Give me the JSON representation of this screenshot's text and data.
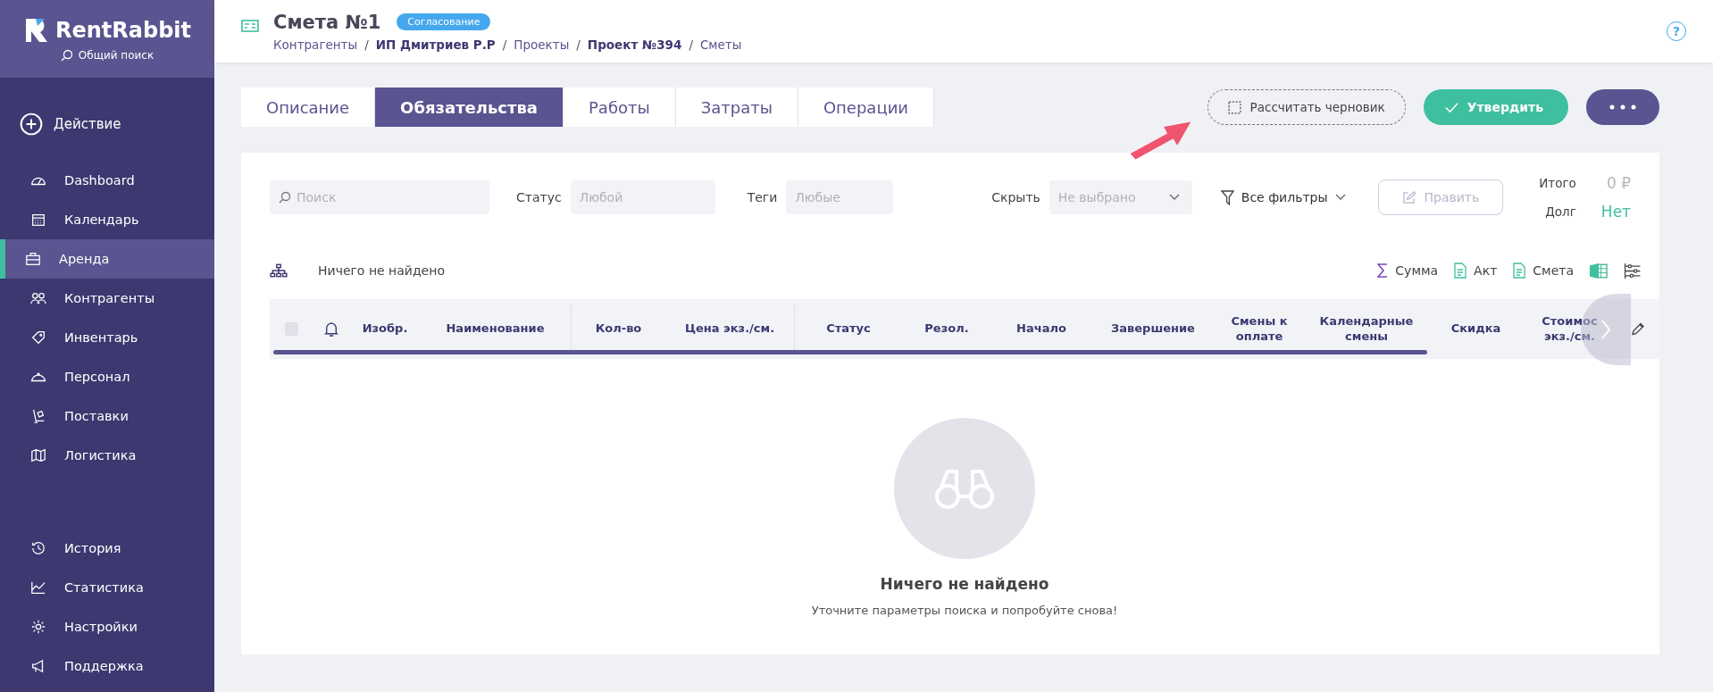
{
  "sidebar": {
    "logo": "RentRabbit",
    "search": "Общий поиск",
    "action": "Действие",
    "items": [
      {
        "label": "Dashboard",
        "selected": false
      },
      {
        "label": "Календарь",
        "selected": false
      },
      {
        "label": "Аренда",
        "selected": true
      },
      {
        "label": "Контрагенты",
        "selected": false
      },
      {
        "label": "Инвентарь",
        "selected": false
      },
      {
        "label": "Персонал",
        "selected": false
      },
      {
        "label": "Поставки",
        "selected": false
      },
      {
        "label": "Логистика",
        "selected": false
      }
    ],
    "bottom_items": [
      {
        "label": "История",
        "selected": false
      },
      {
        "label": "Статистика",
        "selected": false
      },
      {
        "label": "Настройки",
        "selected": false
      },
      {
        "label": "Поддержка",
        "selected": false
      }
    ]
  },
  "header": {
    "title": "Смета №1",
    "status": "Согласование",
    "help": "?",
    "separator": "/",
    "breadcrumbs": [
      {
        "label": "Контрагенты",
        "bold": false
      },
      {
        "label": "ИП Дмитриев Р.Р",
        "bold": true
      },
      {
        "label": "Проекты",
        "bold": false
      },
      {
        "label": "Проект №394",
        "bold": true
      },
      {
        "label": "Сметы",
        "bold": false
      }
    ]
  },
  "tabs": [
    {
      "label": "Описание",
      "selected": false
    },
    {
      "label": "Обязательства",
      "selected": true
    },
    {
      "label": "Работы",
      "selected": false
    },
    {
      "label": "Затраты",
      "selected": false
    },
    {
      "label": "Операции",
      "selected": false
    }
  ],
  "actions": {
    "draft": "Рассчитать черновик",
    "approve": "Утвердить"
  },
  "filters": {
    "search": {
      "placeholder": "Поиск"
    },
    "status": {
      "label": "Статус",
      "placeholder": "Любой"
    },
    "tags": {
      "label": "Теги",
      "placeholder": "Любые"
    },
    "hide": {
      "label": "Скрыть",
      "placeholder": "Не выбрано"
    },
    "all_filters": "Все фильтры",
    "edit": {
      "label": "Править",
      "disabled": true
    }
  },
  "totals": [
    {
      "label": "Итого",
      "value": "0 ₽",
      "color": "#b4b4bc"
    },
    {
      "label": "Долг",
      "value": "Нет",
      "color": "#3ebf9f"
    }
  ],
  "toolbar": {
    "result": "Ничего не найдено",
    "tools": [
      "Сумма",
      "Акт",
      "Смета"
    ]
  },
  "table": {
    "select_all": {
      "checked": false
    },
    "columns": [
      "Изобр.",
      "Наименование",
      "Кол-во",
      "Цена экз./см.",
      "Статус",
      "Резол.",
      "Начало",
      "Завершение",
      "Смены к оплате",
      "Календарные смены",
      "Скидка",
      "Стоимос экз./см."
    ]
  },
  "empty": {
    "title": "Ничего не найдено",
    "hint": "Уточните параметры поиска и попробуйте снова!"
  }
}
